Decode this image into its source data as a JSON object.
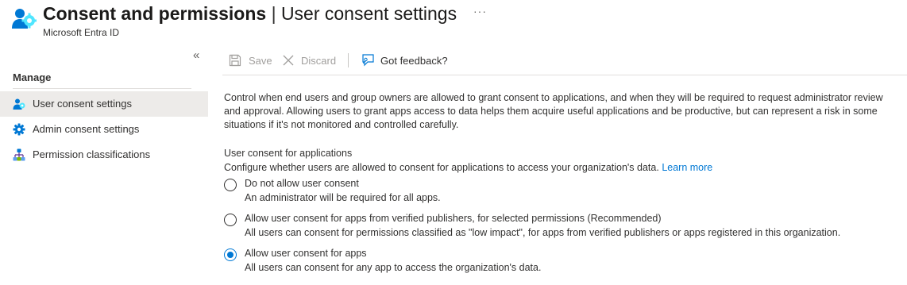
{
  "header": {
    "title_main": "Consent and permissions",
    "title_separator": "|",
    "title_sub": "User consent settings",
    "more_label": "···",
    "subtitle": "Microsoft Entra ID"
  },
  "sidebar": {
    "collapse_label": "«",
    "section_label": "Manage",
    "items": [
      {
        "label": "User consent settings",
        "icon": "user-gear-icon",
        "active": true
      },
      {
        "label": "Admin consent settings",
        "icon": "gear-icon",
        "active": false
      },
      {
        "label": "Permission classifications",
        "icon": "hierarchy-icon",
        "active": false
      }
    ]
  },
  "toolbar": {
    "save_label": "Save",
    "discard_label": "Discard",
    "feedback_label": "Got feedback?"
  },
  "main": {
    "description": "Control when end users and group owners are allowed to grant consent to applications, and when they will be required to request administrator review and approval. Allowing users to grant apps access to data helps them acquire useful applications and be productive, but can represent a risk in some situations if it's not monitored and controlled carefully.",
    "section_title": "User consent for applications",
    "section_desc": "Configure whether users are allowed to consent for applications to access your organization's data.",
    "learn_more": "Learn more",
    "options": [
      {
        "label": "Do not allow user consent",
        "desc": "An administrator will be required for all apps.",
        "checked": false
      },
      {
        "label": "Allow user consent for apps from verified publishers, for selected permissions (Recommended)",
        "desc": "All users can consent for permissions classified as \"low impact\", for apps from verified publishers or apps registered in this organization.",
        "checked": false
      },
      {
        "label": "Allow user consent for apps",
        "desc": "All users can consent for any app to access the organization's data.",
        "checked": true
      }
    ]
  },
  "colors": {
    "accent": "#0078d4",
    "nav_active_bg": "#edebe9",
    "disabled_text": "#a19f9d"
  }
}
